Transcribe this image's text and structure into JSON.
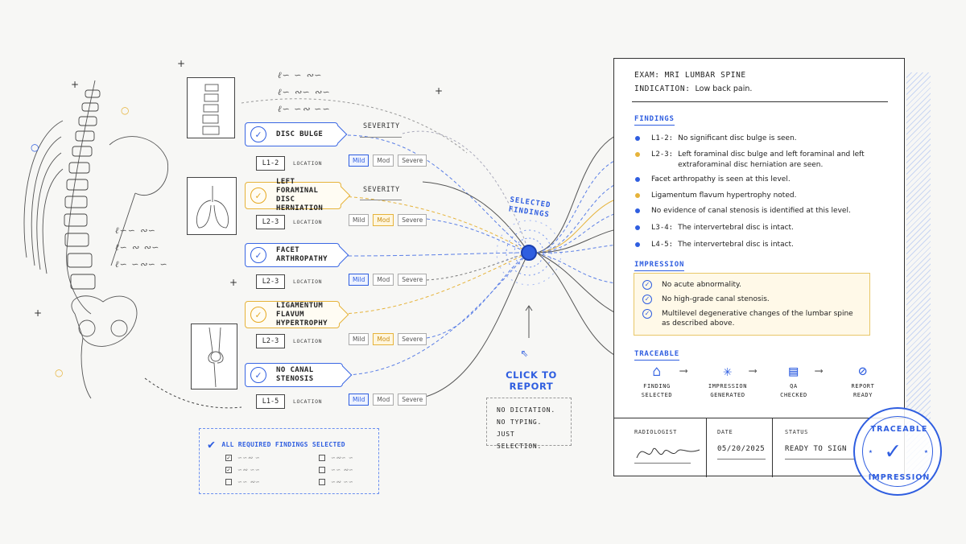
{
  "findings": [
    {
      "label": "DISC BULGE",
      "level": "L1-2",
      "severity": "Mild",
      "color": "#3a67e4"
    },
    {
      "label": "LEFT FORAMINAL DISC HERNIATION",
      "level": "L2-3",
      "severity": "Mod",
      "color": "#e6b33a"
    },
    {
      "label": "FACET ARTHROPATHY",
      "level": "L2-3",
      "severity": "Mild",
      "color": "#3a67e4"
    },
    {
      "label": "LIGAMENTUM FLAVUM HYPERTROPHY",
      "level": "L2-3",
      "severity": "Mod",
      "color": "#e6b33a"
    },
    {
      "label": "NO CANAL STENOSIS",
      "level": "L1-5",
      "severity": "Mild",
      "color": "#3a67e4"
    }
  ],
  "labels": {
    "severity": "SEVERITY",
    "location": "LOCATION",
    "sev_mild": "Mild",
    "sev_mod": "Mod",
    "sev_severe": "Severe"
  },
  "required": {
    "title": "ALL REQUIRED FINDINGS SELECTED"
  },
  "center": {
    "selected_line1": "SELECTED",
    "selected_line2": "FINDINGS",
    "click_to_report": "CLICK TO REPORT",
    "note_line1": "NO DICTATION.",
    "note_line2": "NO TYPING.",
    "note_line3": "JUST SELECTION."
  },
  "report": {
    "exam_label": "EXAM:",
    "exam_value": "MRI LUMBAR SPINE",
    "indication_label": "INDICATION:",
    "indication_value": "Low back pain.",
    "findings_title": "FINDINGS",
    "findings": [
      {
        "level": "L1-2:",
        "text": "No significant disc bulge is seen.",
        "color": "#2f5ee0"
      },
      {
        "level": "L2-3:",
        "text": "Left foraminal disc bulge and left foraminal and left extraforaminal disc herniation are seen.",
        "color": "#e6b33a"
      },
      {
        "level": "",
        "text": "Facet arthropathy is seen at this level.",
        "color": "#2f5ee0"
      },
      {
        "level": "",
        "text": "Ligamentum flavum hypertrophy noted.",
        "color": "#e6b33a"
      },
      {
        "level": "",
        "text": "No evidence of canal stenosis is identified at this level.",
        "color": "#2f5ee0"
      },
      {
        "level": "L3-4:",
        "text": "The intervertebral disc is intact.",
        "color": "#2f5ee0"
      },
      {
        "level": "L4-5:",
        "text": "The intervertebral disc is intact.",
        "color": "#2f5ee0"
      }
    ],
    "impression_title": "IMPRESSION",
    "impression": [
      "No acute abnormality.",
      "No high-grade canal stenosis.",
      "Multilevel degenerative changes of the lumbar spine as described above."
    ],
    "traceable_title": "TRACEABLE",
    "steps": [
      {
        "label1": "FINDING",
        "label2": "SELECTED",
        "icon": "tag-icon"
      },
      {
        "label1": "IMPRESSION",
        "label2": "GENERATED",
        "icon": "sparkle-icon"
      },
      {
        "label1": "QA",
        "label2": "CHECKED",
        "icon": "document-icon"
      },
      {
        "label1": "REPORT",
        "label2": "READY",
        "icon": "check-circle-icon"
      }
    ],
    "radiologist_label": "RADIOLOGIST",
    "date_label": "DATE",
    "date_value": "05/20/2025",
    "status_label": "STATUS",
    "status_value": "READY TO SIGN"
  },
  "stamp": {
    "top": "TRACEABLE",
    "bottom": "IMPRESSION"
  },
  "colors": {
    "accent_blue": "#2f5ee0",
    "accent_yellow": "#e6b33a"
  }
}
